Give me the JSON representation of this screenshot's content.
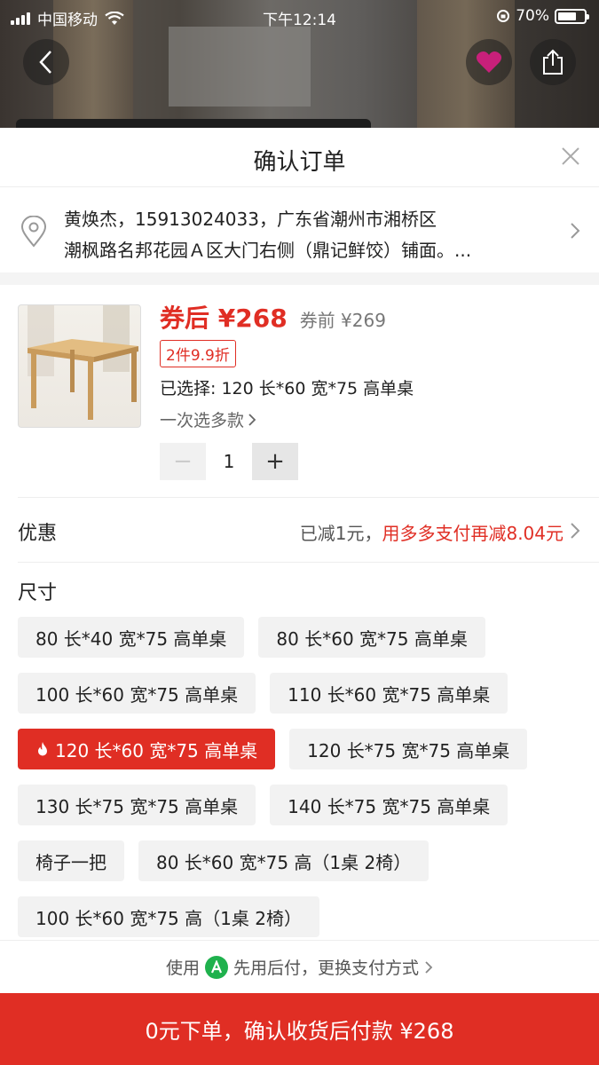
{
  "status_bar": {
    "carrier": "中国移动",
    "time": "下午12:14",
    "battery": "70%",
    "battery_level": 0.7
  },
  "icons": {
    "back": "chevron-left-icon",
    "favorite": "heart-icon",
    "share": "share-icon",
    "close": "close-icon",
    "location": "location-pin-icon",
    "flame": "flame-icon",
    "pay": "pay-later-icon"
  },
  "sheet": {
    "title": "确认订单"
  },
  "address": {
    "line1": "黄焕杰，15913024033，广东省潮州市湘桥区",
    "line2": "潮枫路名邦花园Ａ区大门右侧（鼎记鲜饺）铺面。..."
  },
  "product": {
    "price_after": "券后 ¥268",
    "price_before": "券前 ¥269",
    "discount_tag": "2件9.9折",
    "selected": "已选择: 120 长*60 宽*75 高单桌",
    "multi_select": "一次选多款",
    "quantity": "1",
    "minus": "−",
    "plus": "+"
  },
  "promo": {
    "label": "优惠",
    "reduced": "已减1元，",
    "extra": "用多多支付再减8.04元"
  },
  "size": {
    "title": "尺寸",
    "rows": [
      [
        "80 长*40 宽*75 高单桌",
        "80 长*60 宽*75 高单桌"
      ],
      [
        "100 长*60 宽*75 高单桌",
        "110 长*60 宽*75 高单桌"
      ],
      [
        "120 长*60 宽*75 高单桌",
        "120 长*75 宽*75 高单桌"
      ],
      [
        "130 长*75 宽*75 高单桌",
        "140 长*75 宽*75 高单桌"
      ],
      [
        "椅子一把",
        "80 长*60 宽*75 高（1桌 2椅）"
      ],
      [
        "100 长*60 宽*75 高（1桌 2椅）"
      ]
    ],
    "active": "120 长*60 宽*75 高单桌"
  },
  "payment": {
    "prefix": "使用",
    "method": "先用后付，更换支付方式"
  },
  "cta": {
    "label": "0元下单，确认收货后付款 ¥268"
  },
  "colors": {
    "accent": "#e02e24",
    "pay_green": "#1fb14d"
  }
}
